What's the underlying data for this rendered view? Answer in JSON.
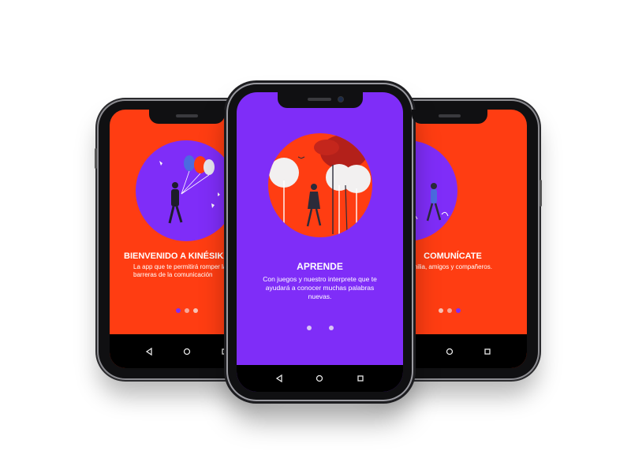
{
  "colors": {
    "orange": "#FF3D12",
    "purple": "#7F2DF8",
    "dot_light": "#D9C4F5",
    "dot_active": "#7F2DF8",
    "dot_pink": "#F7A89A",
    "nav_bar": "#000000"
  },
  "screens": {
    "left": {
      "title": "BIENVENIDO A KINÉSIKA",
      "body": "La app que te permitirá romper las\nbarreras de la comunicación",
      "illustration": "person-with-balloons-illustration"
    },
    "center": {
      "title": "APRENDE",
      "body": "Con juegos y nuestro interprete que te\nayudará a conocer muchas palabras\nnuevas.",
      "illustration": "person-walking-in-forest-illustration"
    },
    "right": {
      "title": "COMUNÍCATE",
      "body": "Con tu familia, amigos y compañeros.",
      "illustration": "person-walking-under-trees-illustration"
    }
  },
  "navbar": {
    "back_icon": "back-triangle-icon",
    "home_icon": "home-circle-icon",
    "recents_icon": "recents-square-icon"
  }
}
